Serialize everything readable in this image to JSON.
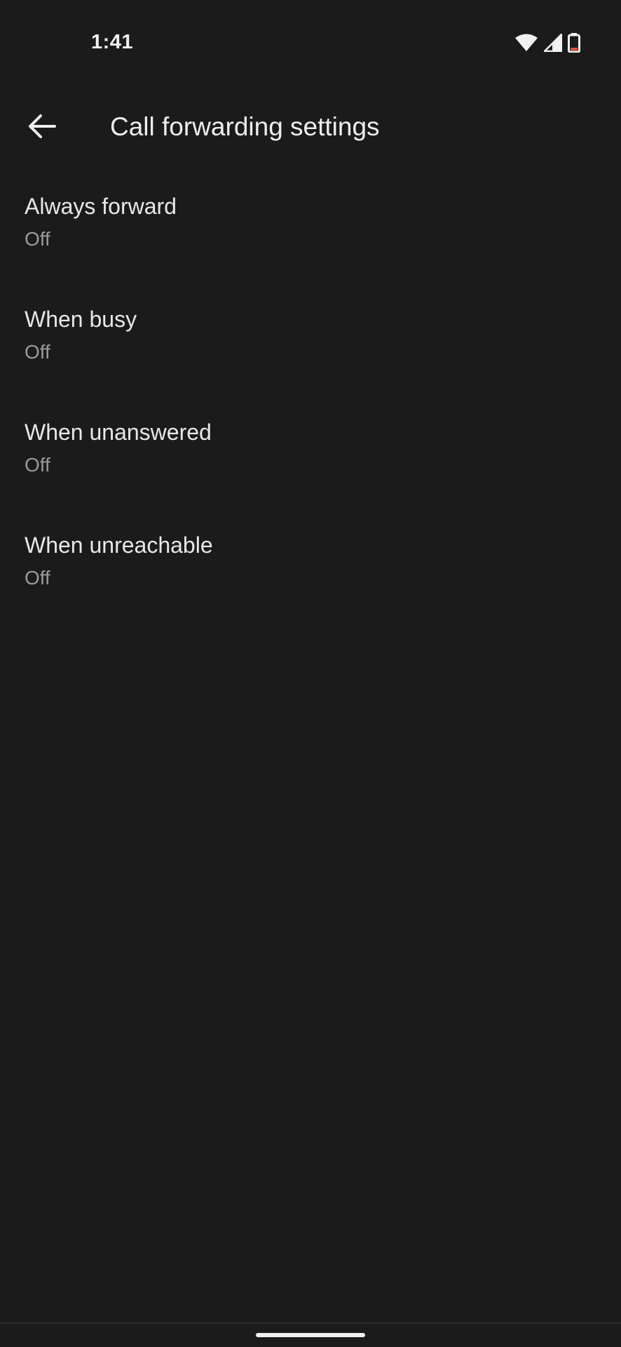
{
  "status_bar": {
    "time": "1:41",
    "icons": [
      "wifi-icon",
      "cell-signal-icon",
      "battery-icon"
    ]
  },
  "app_bar": {
    "back_icon": "arrow-left-icon",
    "title": "Call forwarding settings"
  },
  "settings": {
    "items": [
      {
        "title": "Always forward",
        "summary": "Off"
      },
      {
        "title": "When busy",
        "summary": "Off"
      },
      {
        "title": "When unanswered",
        "summary": "Off"
      },
      {
        "title": "When unreachable",
        "summary": "Off"
      }
    ]
  },
  "colors": {
    "background": "#1b1b1b",
    "primary_text": "#e8e8e8",
    "secondary_text": "#9a9a9a",
    "battery_low": "#e0503a"
  }
}
